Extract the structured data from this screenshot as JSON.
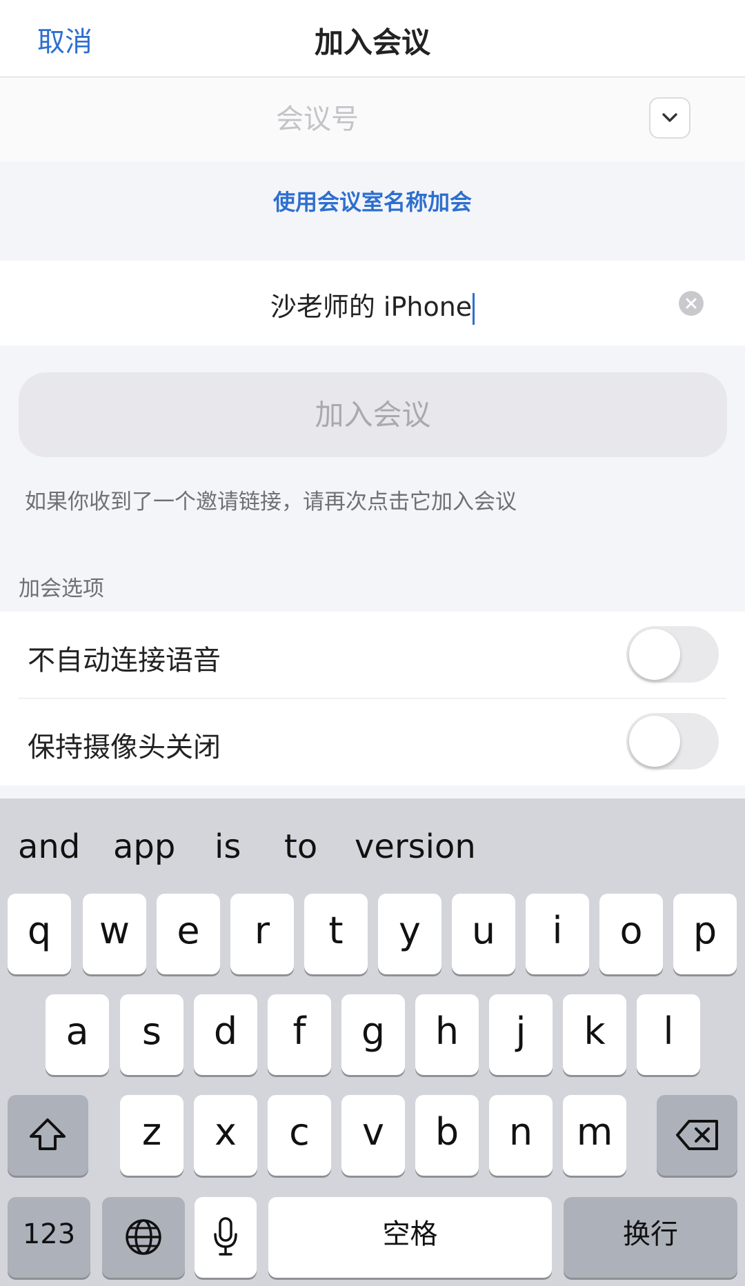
{
  "header": {
    "cancel_label": "取消",
    "title": "加入会议"
  },
  "meeting_id": {
    "value": "",
    "placeholder": "会议号",
    "dropdown_icon": "chevron-down-icon"
  },
  "room_name_link": "使用会议室名称加会",
  "display_name": {
    "value": "沙老师的 iPhone",
    "clear_icon": "clear-x-icon"
  },
  "join_button": {
    "label": "加入会议",
    "enabled": false
  },
  "hint_text": "如果你收到了一个邀请链接，请再次点击它加入会议",
  "options_section": {
    "title": "加会选项",
    "options": [
      {
        "label": "不自动连接语音",
        "on": false
      },
      {
        "label": "保持摄像头关闭",
        "on": false
      }
    ]
  },
  "keyboard": {
    "suggestions": [
      "and",
      "app",
      "is",
      "to",
      "version"
    ],
    "row1": [
      "q",
      "w",
      "e",
      "r",
      "t",
      "y",
      "u",
      "i",
      "o",
      "p"
    ],
    "row2": [
      "a",
      "s",
      "d",
      "f",
      "g",
      "h",
      "j",
      "k",
      "l"
    ],
    "row3": [
      "z",
      "x",
      "c",
      "v",
      "b",
      "n",
      "m"
    ],
    "shift_icon": "shift-icon",
    "delete_icon": "delete-icon",
    "numbers_label": "123",
    "globe_icon": "globe-icon",
    "mic_icon": "microphone-icon",
    "space_label": "空格",
    "return_label": "换行"
  },
  "colors": {
    "accent": "#2d6fd0",
    "background": "#f4f5f8",
    "keyboard_bg": "#d3d5db"
  }
}
